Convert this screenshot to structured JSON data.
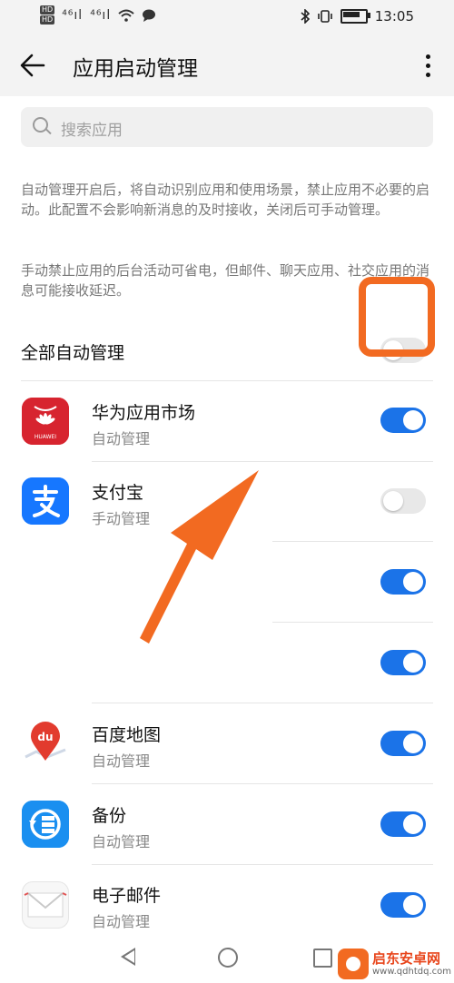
{
  "status_bar": {
    "hd1": "HD",
    "hd2": "HD",
    "signal1": "⁴⁶ıl",
    "signal2": "⁴⁶ıl",
    "time": "13:05"
  },
  "header": {
    "title": "应用启动管理"
  },
  "search": {
    "placeholder": "搜索应用"
  },
  "description": {
    "para1": "自动管理开启后，将自动识别应用和使用场景，禁止应用不必要的启动。此配置不会影响新消息的及时接收，关闭后可手动管理。",
    "para2": "手动禁止应用的后台活动可省电，但邮件、聊天应用、社交应用的消息可能接收延迟。"
  },
  "all_auto": {
    "label": "全部自动管理",
    "enabled": false
  },
  "apps": [
    {
      "name": "华为应用市场",
      "mode": "自动管理",
      "enabled": true,
      "icon": "huawei-appgallery-icon"
    },
    {
      "name": "支付宝",
      "mode": "手动管理",
      "enabled": false,
      "icon": "alipay-icon"
    },
    {
      "name": "",
      "mode": "",
      "enabled": true,
      "icon": ""
    },
    {
      "name": "",
      "mode": "",
      "enabled": true,
      "icon": ""
    },
    {
      "name": "百度地图",
      "mode": "自动管理",
      "enabled": true,
      "icon": "baidu-map-icon"
    },
    {
      "name": "备份",
      "mode": "自动管理",
      "enabled": true,
      "icon": "backup-icon"
    },
    {
      "name": "电子邮件",
      "mode": "自动管理",
      "enabled": true,
      "icon": "email-icon"
    }
  ],
  "annotation": {
    "highlight_color": "#f26a21",
    "arrow_color": "#f26a21"
  },
  "watermark": {
    "name": "启东安卓网",
    "url": "www.qdhtdq.com"
  },
  "colors": {
    "switch_on": "#1b73e8",
    "switch_off": "#e8e8e8"
  }
}
